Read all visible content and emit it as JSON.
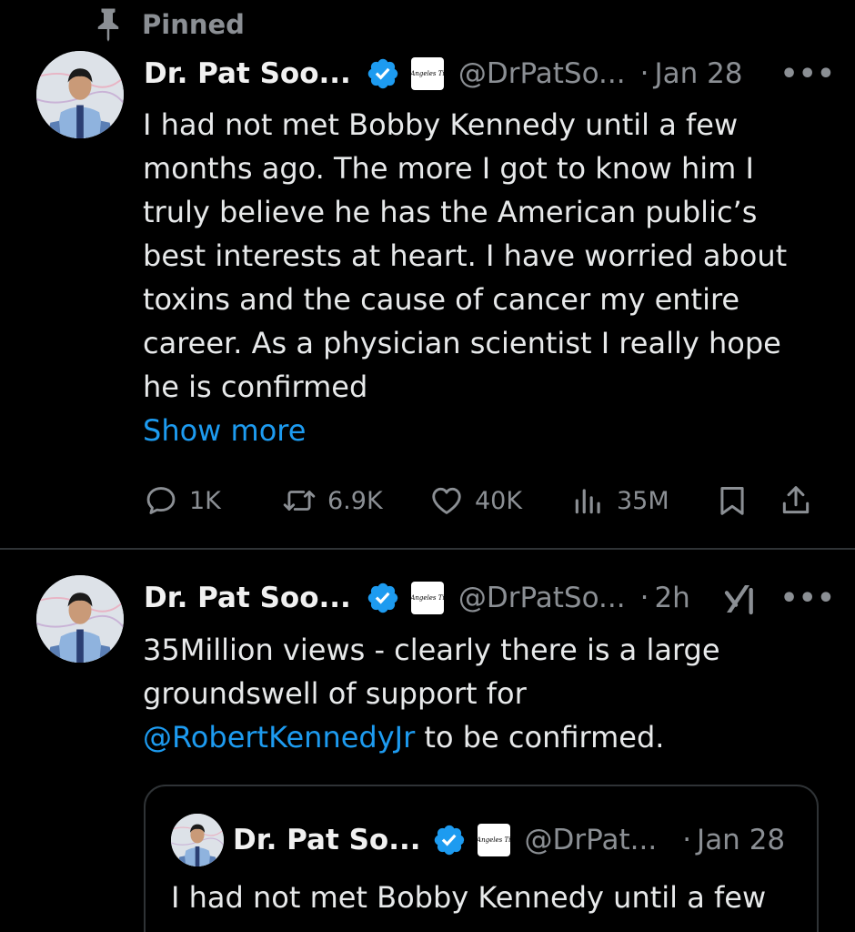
{
  "pinned": {
    "label": "Pinned",
    "icon": "pin-icon"
  },
  "tweet1": {
    "author_name": "Dr. Pat Soo...",
    "handle": "@DrPatSo...",
    "separator": "·",
    "time": "Jan 28",
    "more": "•••",
    "affiliation_badge": "Los Angeles Times",
    "text_lines": [
      "I had not met Bobby Kennedy until a few",
      "months ago. The more I got to know him I",
      "truly believe he has the American public’s",
      "best interests at heart. I have worried about",
      "toxins and the cause of cancer my entire",
      "career. As a physician scientist I really hope",
      "he is confirmed"
    ],
    "show_more": "Show more",
    "replies": "1K",
    "reposts": "6.9K",
    "likes": "40K",
    "views": "35M"
  },
  "tweet2": {
    "author_name": "Dr. Pat Soo...",
    "handle": "@DrPatSo...",
    "separator": "·",
    "time": "2h",
    "more": "•••",
    "affiliation_badge": "Los Angeles Times",
    "text_line1": "35Million views - clearly there is a large",
    "text_line2": "groundswell of support for",
    "mention": "@RobertKennedyJr",
    "text_line3_rest": " to be confirmed.",
    "quote": {
      "author_name": "Dr. Pat So...",
      "handle": "@DrPat...",
      "separator": "·",
      "time": "Jan 28",
      "affiliation_badge": "Los Angeles Times",
      "text_line1": "I had not met Bobby Kennedy until a few"
    }
  },
  "colors": {
    "background": "#000000",
    "accent": "#1d9bf0",
    "muted": "#8b8f94",
    "text": "#e7e9ea",
    "divider": "#2f3336"
  }
}
